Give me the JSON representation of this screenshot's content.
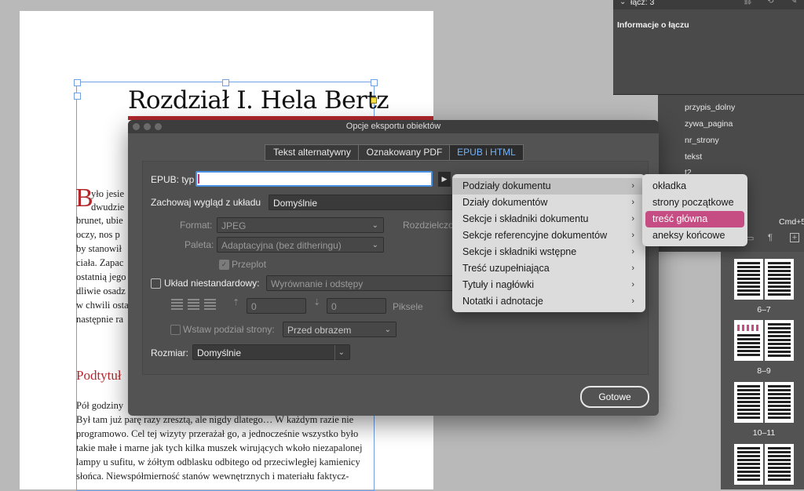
{
  "document": {
    "heading": "Rozdział I. Hela Bertz",
    "dropcap": "B",
    "lines_top": [
      "yło jesie",
      "dwudzie",
      "brunet, ubie",
      "oczy, nos p",
      "by stanowił",
      "ciała. Zapac",
      "ostatnią jego",
      "dliwie osadz",
      "w chwili osta",
      "następnie ra"
    ],
    "subtitle": "Podtytuł",
    "lines_bottom": [
      "Pół godziny",
      "Był tam już parę razy zresztą, ale nigdy dlatego… W każdym razie nie",
      "programowo. Cel tej wizyty przerażał go, a jednocześnie wszystko było",
      "takie małe i marne jak tych kilka muszek wirujących wkoło niezapalonej",
      "lampy u sufitu, w żółtym odblasku odbitego od przeciwległej kamienicy",
      "słońca. Niewspółmierność stanów wewnętrznych i materiału faktycz-"
    ]
  },
  "links_panel": {
    "header": "łącz: 3",
    "info_title": "Informacje o łączu"
  },
  "styles_panel": {
    "items": [
      "przypis_dolny",
      "zywa_pagina",
      "nr_strony",
      "tekst",
      "t2"
    ],
    "shortcut": "Cmd+5"
  },
  "pages_panel": {
    "spreads": [
      "6–7",
      "8–9",
      "10–11"
    ]
  },
  "dialog": {
    "title": "Opcje eksportu obiektów",
    "tabs": [
      "Tekst alternatywny",
      "Oznakowany PDF",
      "EPUB i HTML"
    ],
    "epub_type_label": "EPUB: typ",
    "epub_type_value": "",
    "preserve_label": "Zachowaj wygląd z układu",
    "preserve_value": "Domyślnie",
    "format_label": "Format:",
    "format_value": "JPEG",
    "resolution_label": "Rozdzielczo",
    "palette_label": "Paleta:",
    "palette_value": "Adaptacyjna (bez ditheringu)",
    "interlace_label": "Przeplot",
    "custom_layout_label": "Układ niestandardowy:",
    "custom_layout_value": "Wyrównanie i odstępy",
    "spacing_before": "0",
    "spacing_after": "0",
    "pixels_label": "Piksele",
    "page_break_label": "Wstaw podział strony:",
    "page_break_value": "Przed obrazem",
    "size_label": "Rozmiar:",
    "size_value": "Domyślnie",
    "done_button": "Gotowe"
  },
  "menu": {
    "items": [
      "Podziały dokumentu",
      "Działy dokumentów",
      "Sekcje i składniki dokumentu",
      "Sekcje referencyjne dokumentów",
      "Sekcje i składniki wstępne",
      "Treść uzupełniająca",
      "Tytuły i nagłówki",
      "Notatki i adnotacje"
    ],
    "highlighted_index": 0
  },
  "submenu": {
    "items": [
      "okładka",
      "strony początkowe",
      "treść główna",
      "aneksy końcowe"
    ],
    "highlighted_index": 2
  },
  "colors": {
    "accent_red": "#b3282d",
    "menu_highlight": "#c54d83",
    "selection_blue": "#6fa0e8"
  }
}
